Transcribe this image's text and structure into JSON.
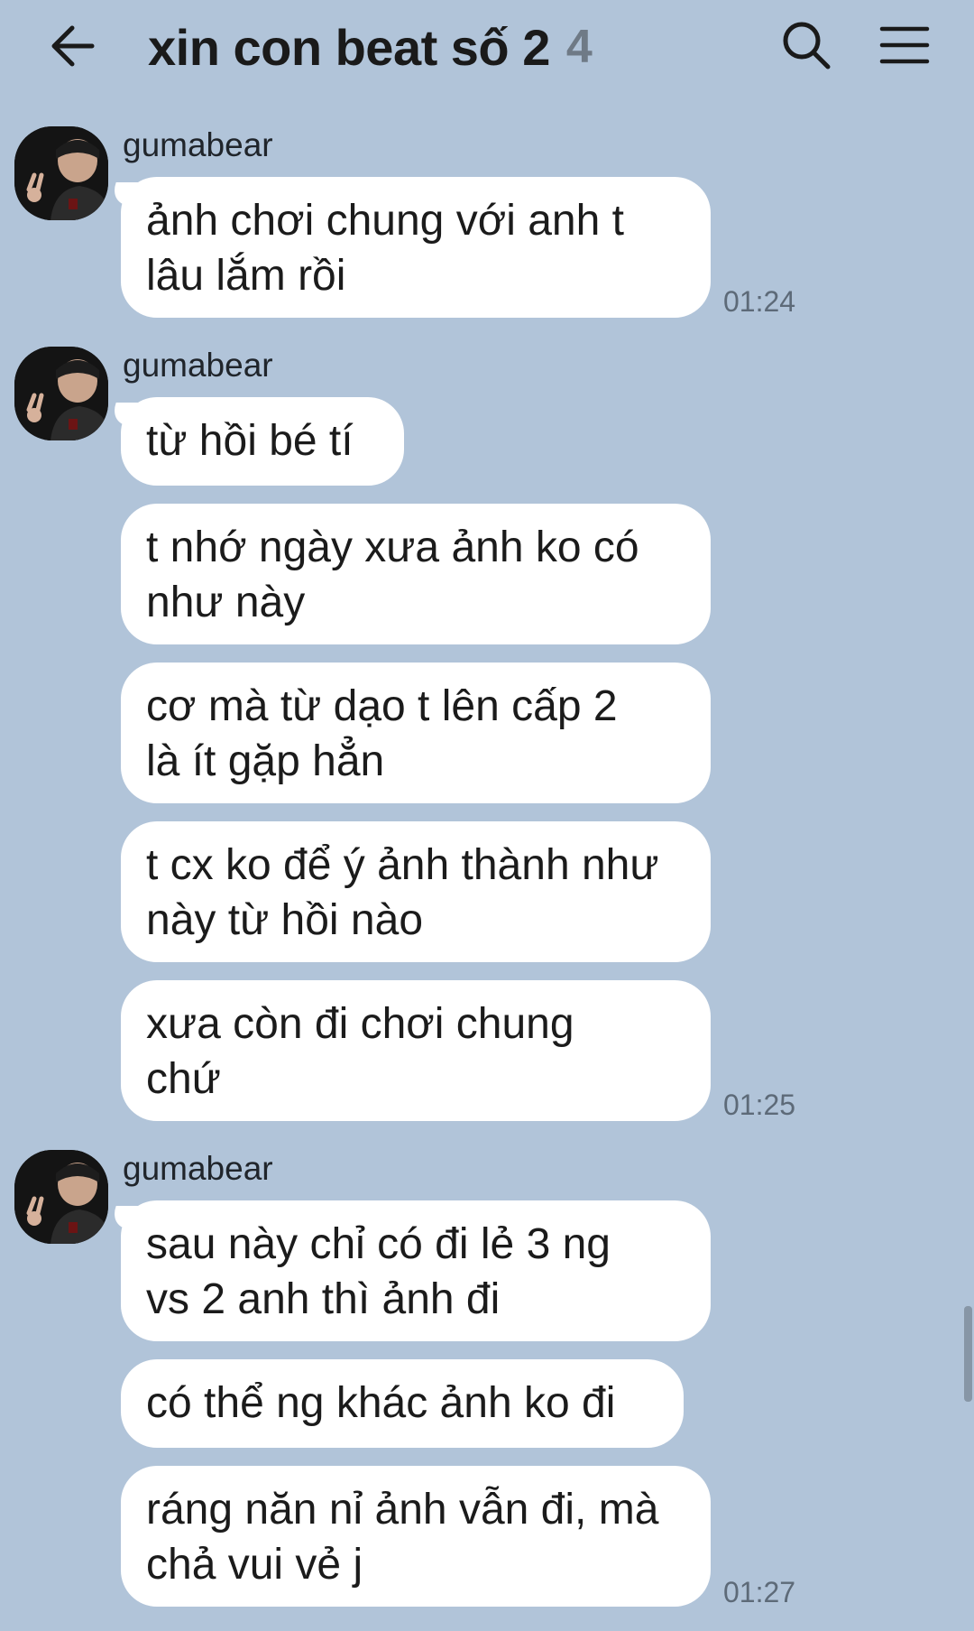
{
  "header": {
    "title": "xin con beat số 2",
    "member_count": "4",
    "back_icon": "arrow-left-icon",
    "search_icon": "search-icon",
    "menu_icon": "hamburger-menu-icon"
  },
  "messages": [
    {
      "sender": "gumabear",
      "time": "01:24",
      "bubbles": [
        "ảnh chơi chung với anh t\nlâu lắm rồi"
      ]
    },
    {
      "sender": "gumabear",
      "time": "01:25",
      "bubbles": [
        "từ hồi bé tí",
        "t nhớ ngày xưa ảnh ko có\nnhư này",
        "cơ mà từ dạo t lên cấp 2\nlà ít gặp hẳn",
        "t cx ko để ý ảnh thành như\nnày từ hồi nào",
        "xưa còn đi chơi chung\nchứ"
      ]
    },
    {
      "sender": "gumabear",
      "time": "01:27",
      "bubbles": [
        "sau này chỉ có đi lẻ 3 ng\nvs 2 anh thì ảnh đi",
        "có thể ng khác ảnh ko đi",
        "ráng năn nỉ ảnh vẫn đi, mà\nchả vui vẻ j"
      ]
    }
  ],
  "colors": {
    "background": "#b1c4d9",
    "bubble": "#ffffff",
    "text": "#1b1b1b",
    "time": "#5d6a78"
  }
}
